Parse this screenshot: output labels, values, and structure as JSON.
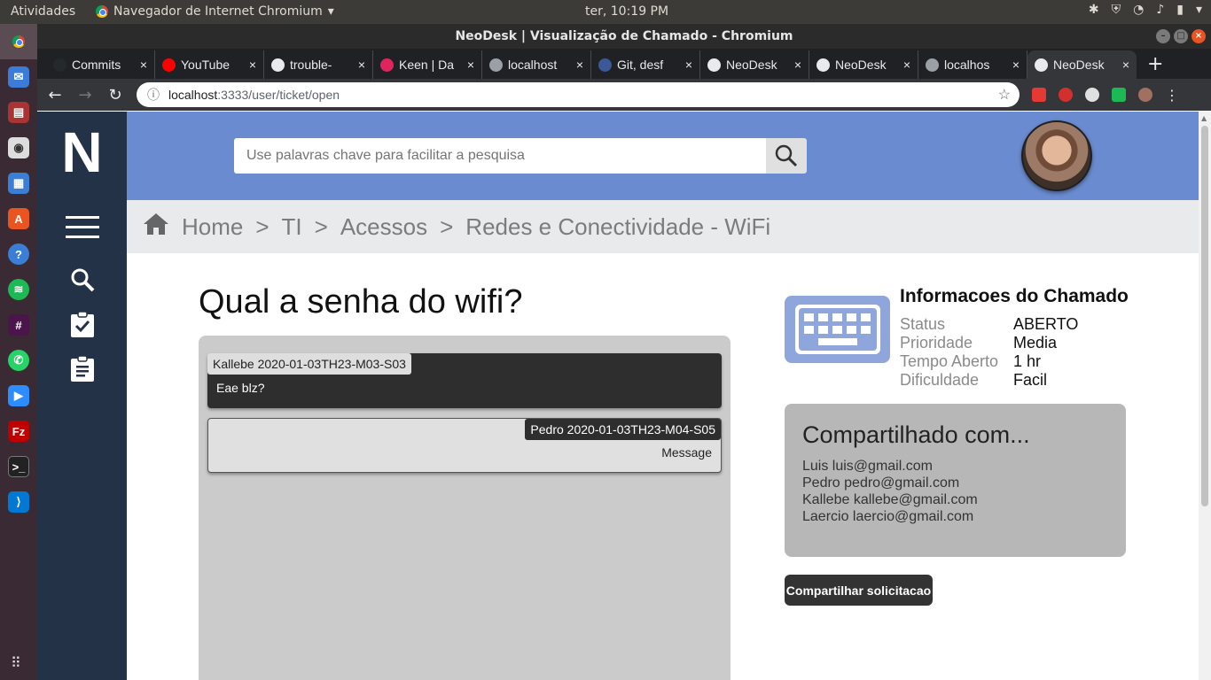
{
  "system": {
    "activities": "Atividades",
    "app_name": "Navegador de Internet Chromium",
    "clock": "ter, 10:19 PM"
  },
  "window": {
    "title": "NeoDesk | Visualização de Chamado - Chromium"
  },
  "tabs": [
    {
      "title": "Commits",
      "favicon_color": "#24292e"
    },
    {
      "title": "YouTube",
      "favicon_color": "#ff0000"
    },
    {
      "title": "trouble-",
      "favicon_color": "#e8eaed"
    },
    {
      "title": "Keen | Da",
      "favicon_color": "#e0245e"
    },
    {
      "title": "localhost",
      "favicon_color": "#9aa0a6"
    },
    {
      "title": "Git, desf",
      "favicon_color": "#3b5998"
    },
    {
      "title": "NeoDesk",
      "favicon_color": "#e8eaed"
    },
    {
      "title": "NeoDesk",
      "favicon_color": "#e8eaed"
    },
    {
      "title": "localhos",
      "favicon_color": "#9aa0a6"
    },
    {
      "title": "NeoDesk",
      "favicon_color": "#e8eaed",
      "active": true
    }
  ],
  "address_bar": {
    "host": "localhost",
    "path": ":3333/user/ticket/open"
  },
  "app": {
    "logo": "N",
    "search_placeholder": "Use palavras chave para facilitar a pesquisa",
    "breadcrumb": [
      "Home",
      "TI",
      "Acessos",
      "Redes e Conectividade - WiFi"
    ],
    "breadcrumb_separator": ">",
    "accent_color": "#6a8bd0",
    "sidebar_color": "#243247"
  },
  "ticket": {
    "question": "Qual a senha do wifi?",
    "messages": [
      {
        "author_stamp": "Kallebe 2020-01-03TH23-M03-S03",
        "text": "Eae blz?"
      },
      {
        "author_stamp": "Pedro 2020-01-03TH23-M04-S05",
        "text": "Message"
      }
    ],
    "info_title": "Informacoes do Chamado",
    "info": [
      {
        "label": "Status",
        "value": "ABERTO"
      },
      {
        "label": "Prioridade",
        "value": "Media"
      },
      {
        "label": "Tempo Aberto",
        "value": "1 hr"
      },
      {
        "label": "Dificuldade",
        "value": "Facil"
      }
    ],
    "shared_title": "Compartilhado com...",
    "shared_with": [
      "Luis luis@gmail.com",
      "Pedro pedro@gmail.com",
      "Kallebe kallebe@gmail.com",
      "Laercio laercio@gmail.com"
    ],
    "share_button": "Compartilhar solicitacao"
  }
}
